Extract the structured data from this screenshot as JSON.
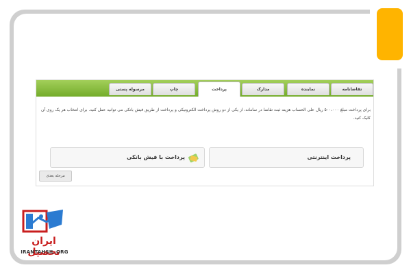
{
  "tabs": [
    {
      "label": "تقاضانامه"
    },
    {
      "label": "نماینده"
    },
    {
      "label": "مدارک"
    },
    {
      "label": "پرداخت"
    },
    {
      "label": "چاپ"
    },
    {
      "label": "مرسوله پستی"
    }
  ],
  "active_tab": "پرداخت",
  "description": "برای پرداخت مبلغ ۵۰۰،۰۰۰ ریال علی الحساب هزینه ثبت تقاضا در سامانه، از یکی از دو روش پرداخت الکترونیکی و پرداخت از طریق فیش بانکی می توانید عمل کنید. برای انتخاب هر یک روی آن کلیک کنید.",
  "options": {
    "online_label": "پرداخت اینترنتی",
    "bank_slip_label": "پرداخت با فیش بانکی"
  },
  "next_button": "مرحله بعدی",
  "logo": {
    "text": "ایران تحصیل",
    "url": "IRANTAHSIL.ORG"
  },
  "colors": {
    "accent_green": "#8cc63f",
    "orange": "#ffb400",
    "logo_red": "#c81e1e"
  }
}
